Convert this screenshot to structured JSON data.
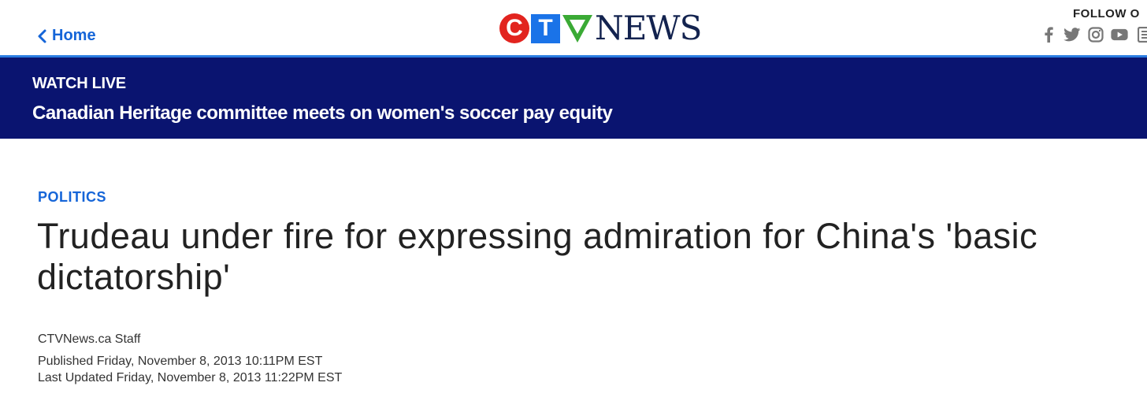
{
  "header": {
    "home_label": "Home",
    "logo": {
      "c": "C",
      "t": "T",
      "news": "NEWS",
      "colors": {
        "c": "#e2241f",
        "t": "#1a73e8",
        "v": "#3aaa35",
        "news": "#13234f"
      }
    },
    "follow_label": "FOLLOW O",
    "social_icons": [
      "facebook-icon",
      "twitter-icon",
      "instagram-icon",
      "youtube-icon",
      "rss-icon"
    ]
  },
  "banner": {
    "watch_label": "WATCH LIVE",
    "headline": "Canadian Heritage committee meets on women's soccer pay equity",
    "background": "#0a1470"
  },
  "article": {
    "category": "POLITICS",
    "title": "Trudeau under fire for expressing admiration for China's 'basic dictatorship'",
    "byline": "CTVNews.ca Staff",
    "published": "Published Friday, November 8, 2013 10:11PM EST",
    "updated": "Last Updated Friday, November 8, 2013 11:22PM EST"
  },
  "colors": {
    "accent": "#1565d8",
    "rule": "#2a7de1",
    "text": "#222222"
  }
}
